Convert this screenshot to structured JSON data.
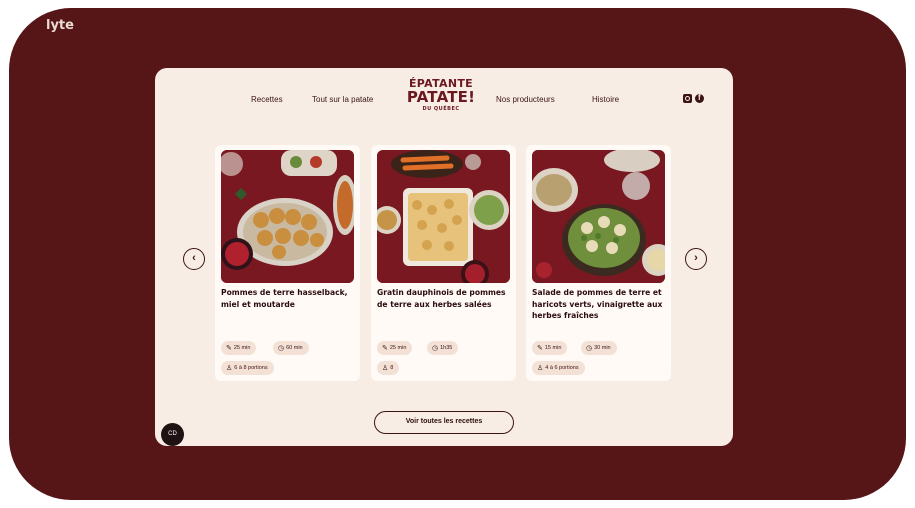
{
  "watermark": "lyte",
  "header": {
    "nav_left": [
      "Recettes",
      "Tout sur la patate"
    ],
    "nav_right": [
      "Nos producteurs",
      "Histoire"
    ],
    "logo": {
      "line1": "ÉPATANTE",
      "line2": "PATATE!",
      "line3": "DU QUÉBEC"
    },
    "social": [
      "instagram-icon",
      "facebook-icon"
    ]
  },
  "carousel": {
    "prev_icon": "chevron-left-icon",
    "next_icon": "chevron-right-icon",
    "cards": [
      {
        "title": "Pommes de terre hasselback, miel et moutarde",
        "prep": "25 min",
        "cook": "60 min",
        "servings": "6 à 8 portions"
      },
      {
        "title": "Gratin dauphinois de pommes de terre aux herbes salées",
        "prep": "25 min",
        "cook": "1h35",
        "servings": "8"
      },
      {
        "title": "Salade de pommes de terre et haricots verts, vinaigrette aux herbes fraîches",
        "prep": "15 min",
        "cook": "30 min",
        "servings": "4 à 6 portions"
      }
    ]
  },
  "cta_label": "Voir toutes les recettes",
  "badge": "CD",
  "colors": {
    "frame": "#561617",
    "site_bg": "#f7ede4",
    "logo": "#6b1820",
    "text": "#3b1416",
    "chip": "#f3e1d6"
  }
}
